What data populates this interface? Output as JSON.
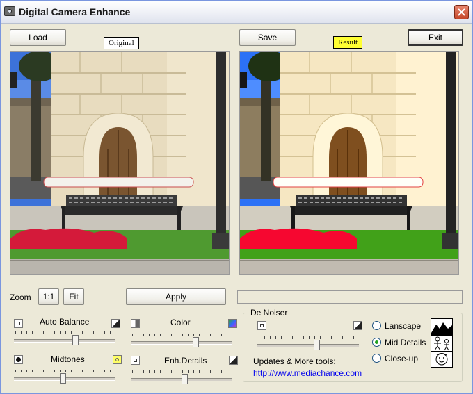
{
  "window": {
    "title": "Digital Camera Enhance"
  },
  "toolbar": {
    "load_label": "Load",
    "save_label": "Save",
    "exit_label": "Exit"
  },
  "tags": {
    "original": "Original",
    "result": "Result"
  },
  "zoom": {
    "label": "Zoom",
    "one_to_one": "1:1",
    "fit": "Fit"
  },
  "apply_label": "Apply",
  "progress": {
    "value": 0
  },
  "sliders": {
    "auto_balance": {
      "label": "Auto Balance",
      "value": 0.6
    },
    "color": {
      "label": "Color",
      "value": 0.64
    },
    "midtones": {
      "label": "Midtones",
      "value": 0.48
    },
    "enh_details": {
      "label": "Enh.Details",
      "value": 0.53
    }
  },
  "denoiser": {
    "title": "De Noiser",
    "slider_value": 0.58,
    "options": [
      {
        "label": "Lanscape",
        "selected": false
      },
      {
        "label": "Mid Details",
        "selected": true
      },
      {
        "label": "Close-up",
        "selected": false
      }
    ],
    "updates_text": "Updates & More tools:",
    "link_text": "http://www.mediachance.com"
  },
  "colors": {
    "accent": "#3a6ea5",
    "result_tag": "#ffff33",
    "close": "#c5472a"
  }
}
